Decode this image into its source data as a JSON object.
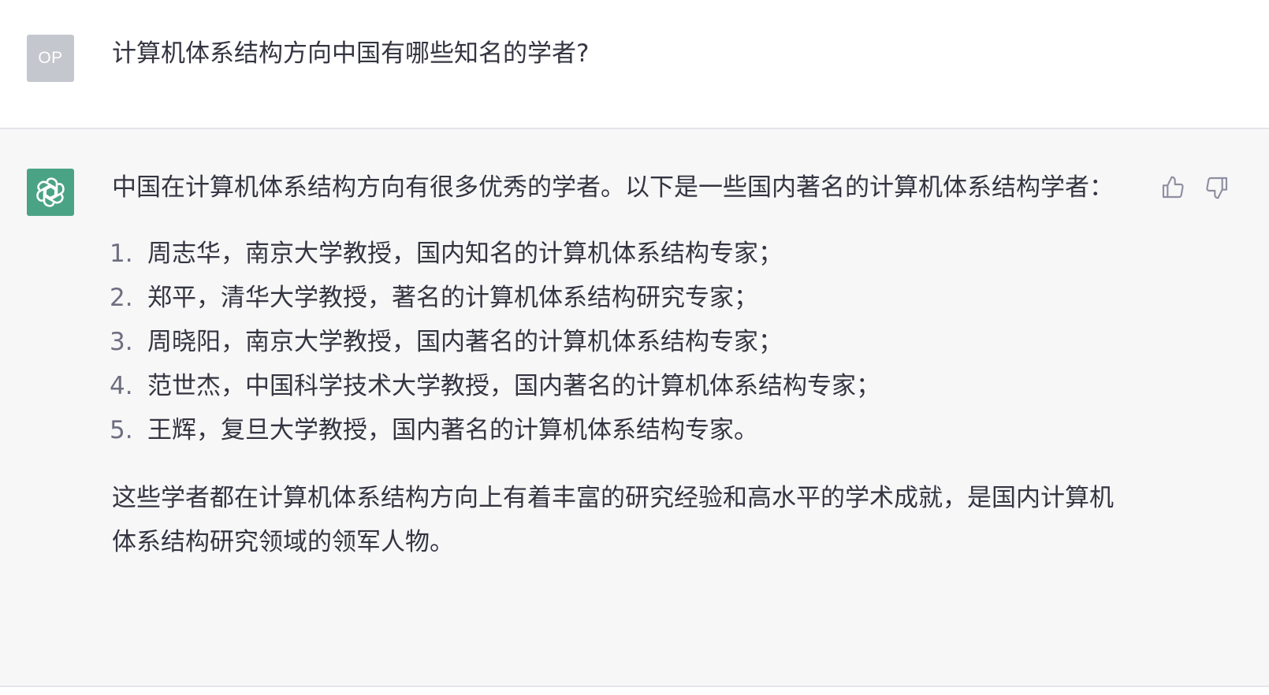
{
  "user_message": {
    "avatar_text": "OP",
    "text": "计算机体系结构方向中国有哪些知名的学者?"
  },
  "assistant_message": {
    "avatar_icon": "openai-logo-icon",
    "avatar_color": "#4ba385",
    "intro": "中国在计算机体系结构方向有很多优秀的学者。以下是一些国内著名的计算机体系结构学者：",
    "items": [
      {
        "num": "1.",
        "text": "周志华，南京大学教授，国内知名的计算机体系结构专家；"
      },
      {
        "num": "2.",
        "text": "郑平，清华大学教授，著名的计算机体系结构研究专家；"
      },
      {
        "num": "3.",
        "text": "周晓阳，南京大学教授，国内著名的计算机体系结构专家；"
      },
      {
        "num": "4.",
        "text": "范世杰，中国科学技术大学教授，国内著名的计算机体系结构专家；"
      },
      {
        "num": "5.",
        "text": "王辉，复旦大学教授，国内著名的计算机体系结构专家。"
      }
    ],
    "conclusion": "这些学者都在计算机体系结构方向上有着丰富的研究经验和高水平的学术成就，是国内计算机体系结构研究领域的领军人物。",
    "feedback": {
      "thumbs_up_icon": "thumbs-up-icon",
      "thumbs_down_icon": "thumbs-down-icon"
    }
  },
  "colors": {
    "user_avatar_bg": "#c5c7ce",
    "assistant_bg": "#f7f7f8",
    "text": "#343541"
  }
}
